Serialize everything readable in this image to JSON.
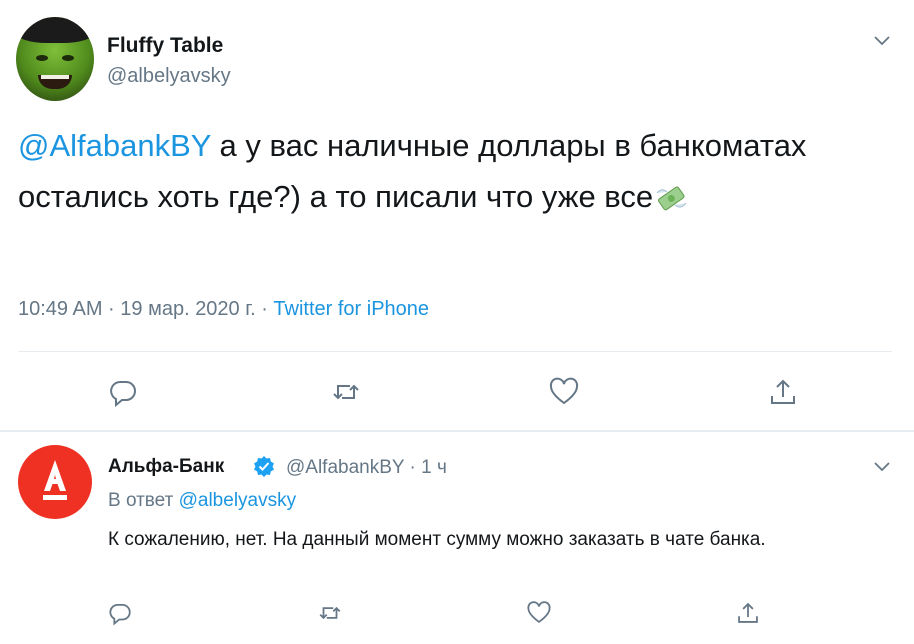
{
  "tweet": {
    "author_name": "Fluffy Table",
    "author_handle": "@albelyavsky",
    "text_mention": "@AlfabankBY",
    "text_body": " а у вас наличные доллары в банкоматах остались хоть где?) а то писали что уже все",
    "emoji": "money-with-wings-icon",
    "timestamp": "10:49 AM · 19 мар. 2020 г. · ",
    "source": "Twitter for iPhone"
  },
  "reply": {
    "author_name": "Альфа-Банк",
    "author_handle": "@AlfabankBY · 1 ч",
    "reply_to_prefix": "В ответ ",
    "reply_to_handle": "@albelyavsky",
    "text": "К сожалению, нет. На данный момент сумму можно заказать в чате банка."
  },
  "actions": [
    "reply-icon",
    "retweet-icon",
    "like-icon",
    "share-icon"
  ],
  "colors": {
    "accent": "#1b95e0",
    "muted": "#657786",
    "alfa_red": "#ef3124",
    "divider": "#e6ecf0"
  }
}
